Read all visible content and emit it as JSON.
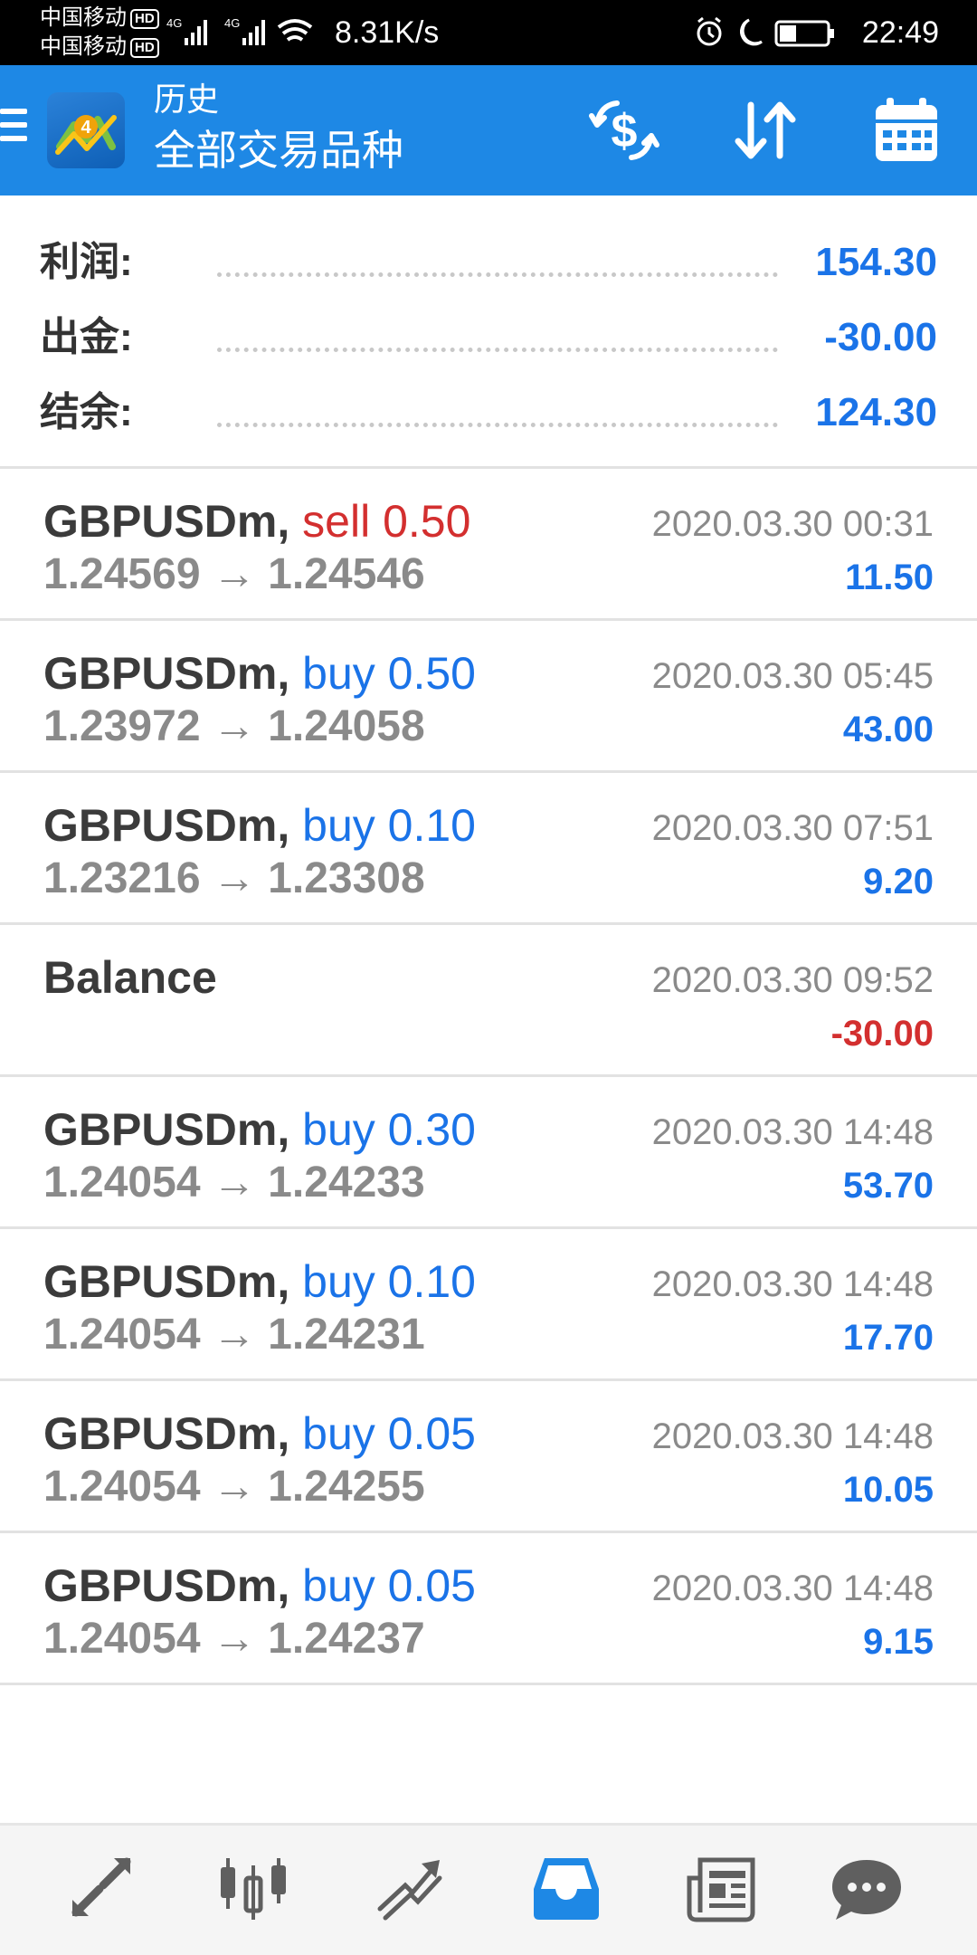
{
  "status_bar": {
    "carrier1": "中国移动",
    "carrier2": "中国移动",
    "hd_badge": "HD",
    "network1": "4G",
    "network2": "4G",
    "speed": "8.31K/s",
    "time": "22:49",
    "icons": [
      "alarm-icon",
      "moon-icon",
      "battery-icon",
      "wifi-icon",
      "signal-icon"
    ]
  },
  "app_bar": {
    "title_small": "历史",
    "title_big": "全部交易品种",
    "icons": [
      "menu-icon",
      "metatrader-logo",
      "currency-exchange-icon",
      "sort-icon",
      "calendar-icon"
    ]
  },
  "summary": {
    "profit": {
      "label": "利润:",
      "value": "154.30"
    },
    "withdrawal": {
      "label": "出金:",
      "value": "-30.00"
    },
    "balance": {
      "label": "结余:",
      "value": "124.30"
    }
  },
  "deals": [
    {
      "symbol": "GBPUSDm,",
      "type": "sell 0.50",
      "type_color": "red",
      "prices": "1.24569 → 1.24546",
      "time": "2020.03.30 00:31",
      "profit": "11.50",
      "profit_color": "blue"
    },
    {
      "symbol": "GBPUSDm,",
      "type": "buy 0.50",
      "type_color": "blue",
      "prices": "1.23972 → 1.24058",
      "time": "2020.03.30 05:45",
      "profit": "43.00",
      "profit_color": "blue"
    },
    {
      "symbol": "GBPUSDm,",
      "type": "buy 0.10",
      "type_color": "blue",
      "prices": "1.23216 → 1.23308",
      "time": "2020.03.30 07:51",
      "profit": "9.20",
      "profit_color": "blue"
    },
    {
      "symbol": "Balance",
      "type": "",
      "type_color": "blue",
      "prices": "",
      "time": "2020.03.30 09:52",
      "profit": "-30.00",
      "profit_color": "red"
    },
    {
      "symbol": "GBPUSDm,",
      "type": "buy 0.30",
      "type_color": "blue",
      "prices": "1.24054 → 1.24233",
      "time": "2020.03.30 14:48",
      "profit": "53.70",
      "profit_color": "blue"
    },
    {
      "symbol": "GBPUSDm,",
      "type": "buy 0.10",
      "type_color": "blue",
      "prices": "1.24054 → 1.24231",
      "time": "2020.03.30 14:48",
      "profit": "17.70",
      "profit_color": "blue"
    },
    {
      "symbol": "GBPUSDm,",
      "type": "buy 0.05",
      "type_color": "blue",
      "prices": "1.24054 → 1.24255",
      "time": "2020.03.30 14:48",
      "profit": "10.05",
      "profit_color": "blue"
    },
    {
      "symbol": "GBPUSDm,",
      "type": "buy 0.05",
      "type_color": "blue",
      "prices": "1.24054 → 1.24237",
      "time": "2020.03.30 14:48",
      "profit": "9.15",
      "profit_color": "blue"
    }
  ],
  "bottom_nav": {
    "items": [
      "quotes-icon",
      "chart-candles-icon",
      "trade-icon",
      "history-inbox-icon",
      "news-icon",
      "chat-icon"
    ],
    "active": "history-inbox-icon"
  },
  "colors": {
    "app_bar": "#1E88E5",
    "positive": "#1a73e8",
    "negative": "#d32f2f",
    "nav_active": "#1E88E5",
    "nav_inactive": "#5f5f5f"
  }
}
